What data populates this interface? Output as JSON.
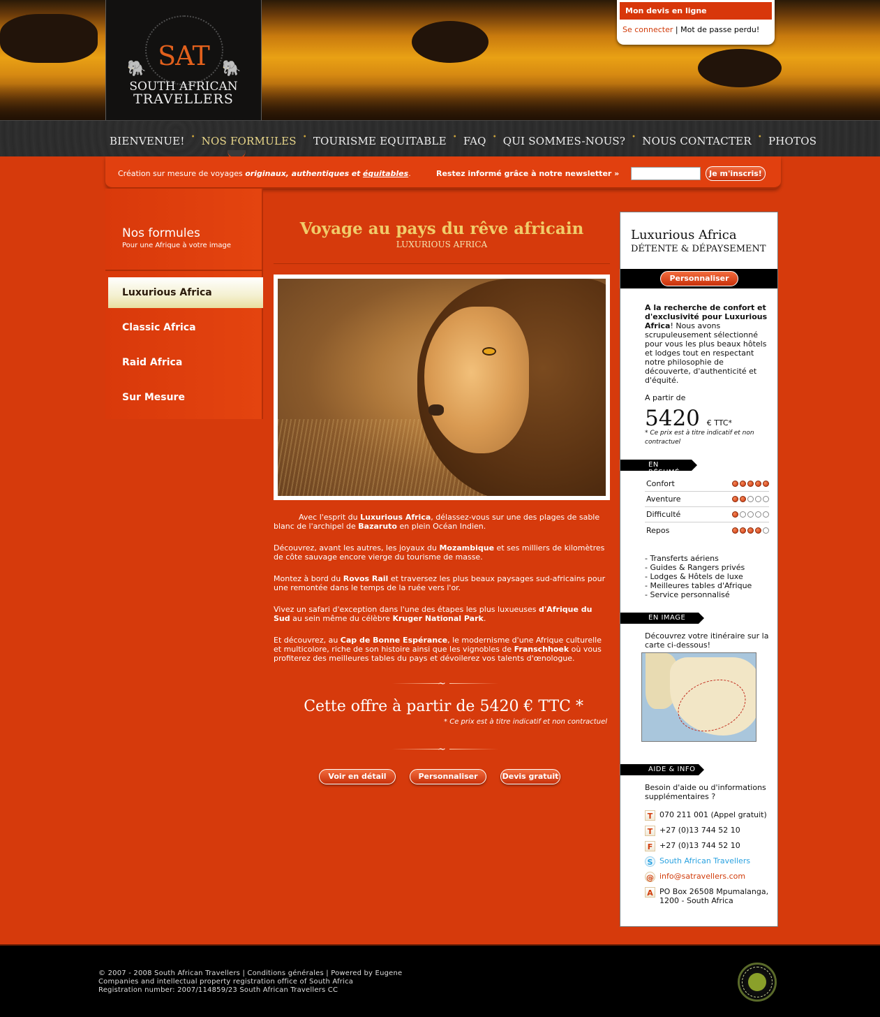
{
  "header": {
    "logo_mark": "SAT",
    "logo_line1": "SOUTH AFRICAN",
    "logo_line2": "TRAVELLERS",
    "quote_title": "Mon devis en ligne",
    "login_link": "Se connecter",
    "link_separator": "|",
    "lost_password_link": "Mot de passe perdu!"
  },
  "nav": {
    "items": [
      {
        "label": "BIENVENUE!"
      },
      {
        "label": "NOS FORMULES"
      },
      {
        "label": "TOURISME EQUITABLE"
      },
      {
        "label": "FAQ"
      },
      {
        "label": "QUI SOMMES-NOUS?"
      },
      {
        "label": "NOUS CONTACTER"
      },
      {
        "label": "PHOTOS"
      }
    ],
    "active": "NOS FORMULES",
    "separator": "•"
  },
  "newsbar": {
    "tagline_prefix": "Création sur mesure de voyages",
    "tagline_em": "originaux, authentiques",
    "tagline_and": "et",
    "tagline_link": "équitables",
    "tagline_suffix": ".",
    "newsletter_label": "Restez informé grâce à notre newsletter »",
    "email_value": "",
    "subscribe_label": "Je m'inscris!"
  },
  "sidebar": {
    "title": "Nos formules",
    "subtitle": "Pour une Afrique à votre image",
    "items": [
      {
        "label": "Luxurious Africa"
      },
      {
        "label": "Classic Africa"
      },
      {
        "label": "Raid Africa"
      },
      {
        "label": "Sur Mesure"
      }
    ],
    "active": "Luxurious Africa"
  },
  "main": {
    "title": "Voyage au pays du rêve africain",
    "subtitle": "LUXURIOUS AFRICA",
    "paragraphs": [
      {
        "p": "Avec l'esprit du ",
        "b1": "Luxurious Africa",
        "m1": ", délassez-vous sur une des plages de sable blanc de l'archipel de ",
        "b2": "Bazaruto",
        "e": " en plein Océan Indien."
      },
      {
        "p": "Découvrez, avant les autres, les joyaux du ",
        "b1": "Mozambique",
        "m1": " et ses milliers de kilomètres de côte sauvage encore vierge du tourisme de masse.",
        "b2": "",
        "e": ""
      },
      {
        "p": "Montez à bord du ",
        "b1": "Rovos Rail",
        "m1": " et traversez les plus beaux paysages sud-africains pour une remontée dans le temps de la ruée vers l'or.",
        "b2": "",
        "e": ""
      },
      {
        "p": "Vivez un safari d'exception dans l'une des étapes les plus luxueuses ",
        "b1": "d'Afrique du Sud",
        "m1": " au sein même du célèbre ",
        "b2": "Kruger National Park",
        "e": "."
      },
      {
        "p": "Et découvrez, au ",
        "b1": "Cap de Bonne Espérance",
        "m1": ", le modernisme d'une Afrique culturelle et multicolore, riche de son histoire ainsi que les vignobles de ",
        "b2": "Franschhoek",
        "e": " où vous profiterez des meilleures tables du pays et dévoilerez vos talents d'œnologue."
      }
    ],
    "ornament": "~",
    "offer": "Cette offre à partir de 5420 € TTC *",
    "offer_note": "* Ce prix est à titre indicatif et non contractuel",
    "buttons": {
      "detail": "Voir en détail",
      "customize": "Personnaliser",
      "quote": "Devis gratuit"
    }
  },
  "rpanel": {
    "title": "Luxurious Africa",
    "subtitle": "DÉTENTE & DÉPAYSEMENT",
    "customize": "Personnaliser",
    "intro_bold": "A la recherche de confort et d'exclusivité pour Luxurious Africa",
    "intro_rest": "! Nous avons scrupuleusement sélectionné pour vous les plus beaux hôtels et lodges tout en respectant notre philosophie de découverte, d'authenticité et d'équité.",
    "from_label": "A partir de",
    "price": "5420",
    "price_unit": "€ TTC*",
    "price_note": "* Ce prix est à titre indicatif et non contractuel",
    "summary_tag": "EN RÉSUMÉ",
    "ratings": [
      {
        "label": "Confort",
        "value": 5
      },
      {
        "label": "Aventure",
        "value": 2
      },
      {
        "label": "Difficulté",
        "value": 1
      },
      {
        "label": "Repos",
        "value": 4
      }
    ],
    "rating_max": 5,
    "features": [
      "- Transferts aériens",
      "- Guides & Rangers privés",
      "- Lodges & Hôtels de luxe",
      "- Meilleures tables d'Afrique",
      "- Service personnalisé"
    ],
    "image_tag": "EN IMAGE",
    "image_text": "Découvrez votre itinéraire sur la carte ci-dessous!",
    "help_tag": "AIDE & INFO",
    "help_text": "Besoin d'aide ou d'informations supplémentaires ?",
    "contacts": [
      {
        "icon": "T",
        "text": "070 211 001 (Appel gratuit)"
      },
      {
        "icon": "T",
        "text": "+27 (0)13 744 52 10"
      },
      {
        "icon": "F",
        "text": "+27 (0)13 744 52 10"
      },
      {
        "icon": "S",
        "text": "South African Travellers"
      },
      {
        "icon": "@",
        "text": "info@satravellers.com"
      },
      {
        "icon": "A",
        "text": "PO Box 26508 Mpumalanga, 1200 - South Africa"
      }
    ]
  },
  "footer": {
    "line1": "© 2007 - 2008 South African Travellers | Conditions générales | Powered by Eugene",
    "line2": "Companies and intellectual property registration office of South Africa",
    "line3": "Registration number: 2007/114859/23 South African Travellers CC",
    "badge_text": "FAIR TRADE IN TOURISM SOUTH AFRICA"
  },
  "colors": {
    "accent": "#d6390b",
    "gold": "#f0cc6a",
    "panel": "#ffffff"
  }
}
